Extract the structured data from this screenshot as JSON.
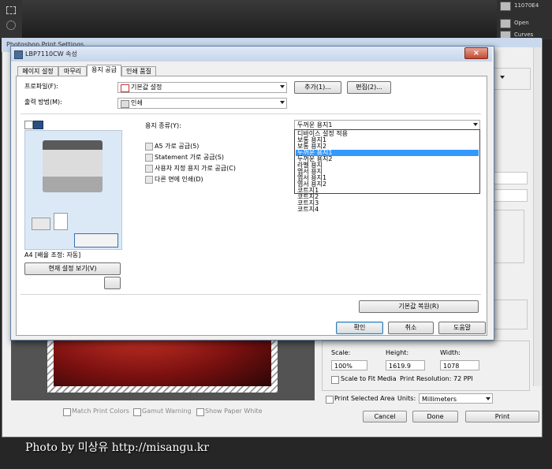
{
  "photoshop": {
    "layers_panel": {
      "items": [
        {
          "label": "11070E4"
        },
        {
          "label": "Open"
        },
        {
          "label": "Curves"
        }
      ]
    },
    "print_settings": {
      "window_title": "Photoshop Print Settings",
      "scale_label": "Scale:",
      "height_label": "Height:",
      "width_label": "Width:",
      "scale_value": "100%",
      "height_value": "1619.9",
      "width_value": "1078",
      "scale_to_fit_label": "Scale to Fit Media",
      "print_resolution": "Print Resolution: 72 PPI",
      "print_selected_area_label": "Print Selected Area",
      "units_label": "Units:",
      "units_value": "Millimeters",
      "match_print_colors_label": "Match Print Colors",
      "gamut_warning_label": "Gamut Warning",
      "show_paper_white_label": "Show Paper White",
      "cancel_label": "Cancel",
      "done_label": "Done",
      "print_label": "Print"
    }
  },
  "watermark": {
    "text": "Photo by 미상유  http://misangu.kr"
  },
  "dialog": {
    "title": "LBP7110CW 속성",
    "close_label": "×",
    "tabs": [
      {
        "label": "페이지 설정",
        "active": false
      },
      {
        "label": "마무리",
        "active": false
      },
      {
        "label": "용지 공급",
        "active": true
      },
      {
        "label": "인쇄 품질",
        "active": false
      }
    ],
    "profile_label": "프로파일(F):",
    "profile_value": "기본값 설정",
    "output_method_label": "출력 방법(M):",
    "output_method_value": "인쇄",
    "add_button": "추가(1)...",
    "edit_button": "편집(2)...",
    "paper_type_label": "용지 종류(Y):",
    "paper_type_value": "두꺼운 용지1",
    "paper_type_options": [
      "디바이스 설정 적용",
      "보통 용지1",
      "보통 용지2",
      "두꺼운 용지1",
      "두꺼운 용지2",
      "라벨 용지",
      "엽서 용지",
      "엽서 용지1",
      "엽서 용지2",
      "코트지1",
      "코트지2",
      "코트지3",
      "코트지4"
    ],
    "selected_option_index": 3,
    "checkboxes": [
      {
        "label": "A5 가로 공급(5)",
        "checked": false
      },
      {
        "label": "Statement 가로 공급(S)",
        "checked": false
      },
      {
        "label": "사용자 지정 용지 가로 공급(C)",
        "checked": false
      },
      {
        "label": "다른 면에 인쇄(D)",
        "checked": false
      }
    ],
    "preview_caption": "A4 [배율 조정: 자동]",
    "view_settings_button": "현재 설정 보기(V)",
    "restore_defaults_button": "기본값 복원(R)",
    "ok_button": "확인",
    "cancel_button": "취소",
    "help_button": "도움말"
  }
}
